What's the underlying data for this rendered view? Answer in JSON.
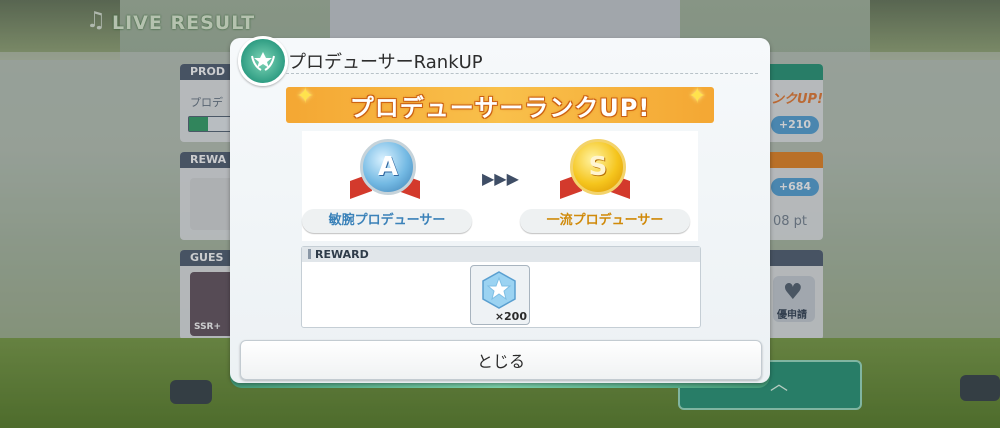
{
  "background": {
    "screen_title": "LIVE RESULT",
    "left_panels": [
      {
        "head": "PROD",
        "text": "プロデ"
      },
      {
        "head": "REWA"
      },
      {
        "head": "GUES",
        "badge": "SSR+"
      }
    ],
    "right_panels": [
      {
        "label": "ンクUP!",
        "pill": "+210"
      },
      {
        "pill": "+684",
        "pt": "08 pt"
      },
      {
        "label": "優申請"
      }
    ]
  },
  "modal": {
    "title": "プロデューサーRankUP",
    "banner": "プロデューサーランクUP!",
    "from_rank": {
      "letter": "A",
      "name": "敏腕プロデューサー"
    },
    "arrows": "▶▶▶",
    "to_rank": {
      "letter": "S",
      "name": "一流プロデューサー"
    },
    "reward": {
      "header": "REWARD",
      "items": [
        {
          "icon": "star-gem-icon",
          "count": "×200"
        }
      ]
    },
    "close_label": "とじる"
  }
}
